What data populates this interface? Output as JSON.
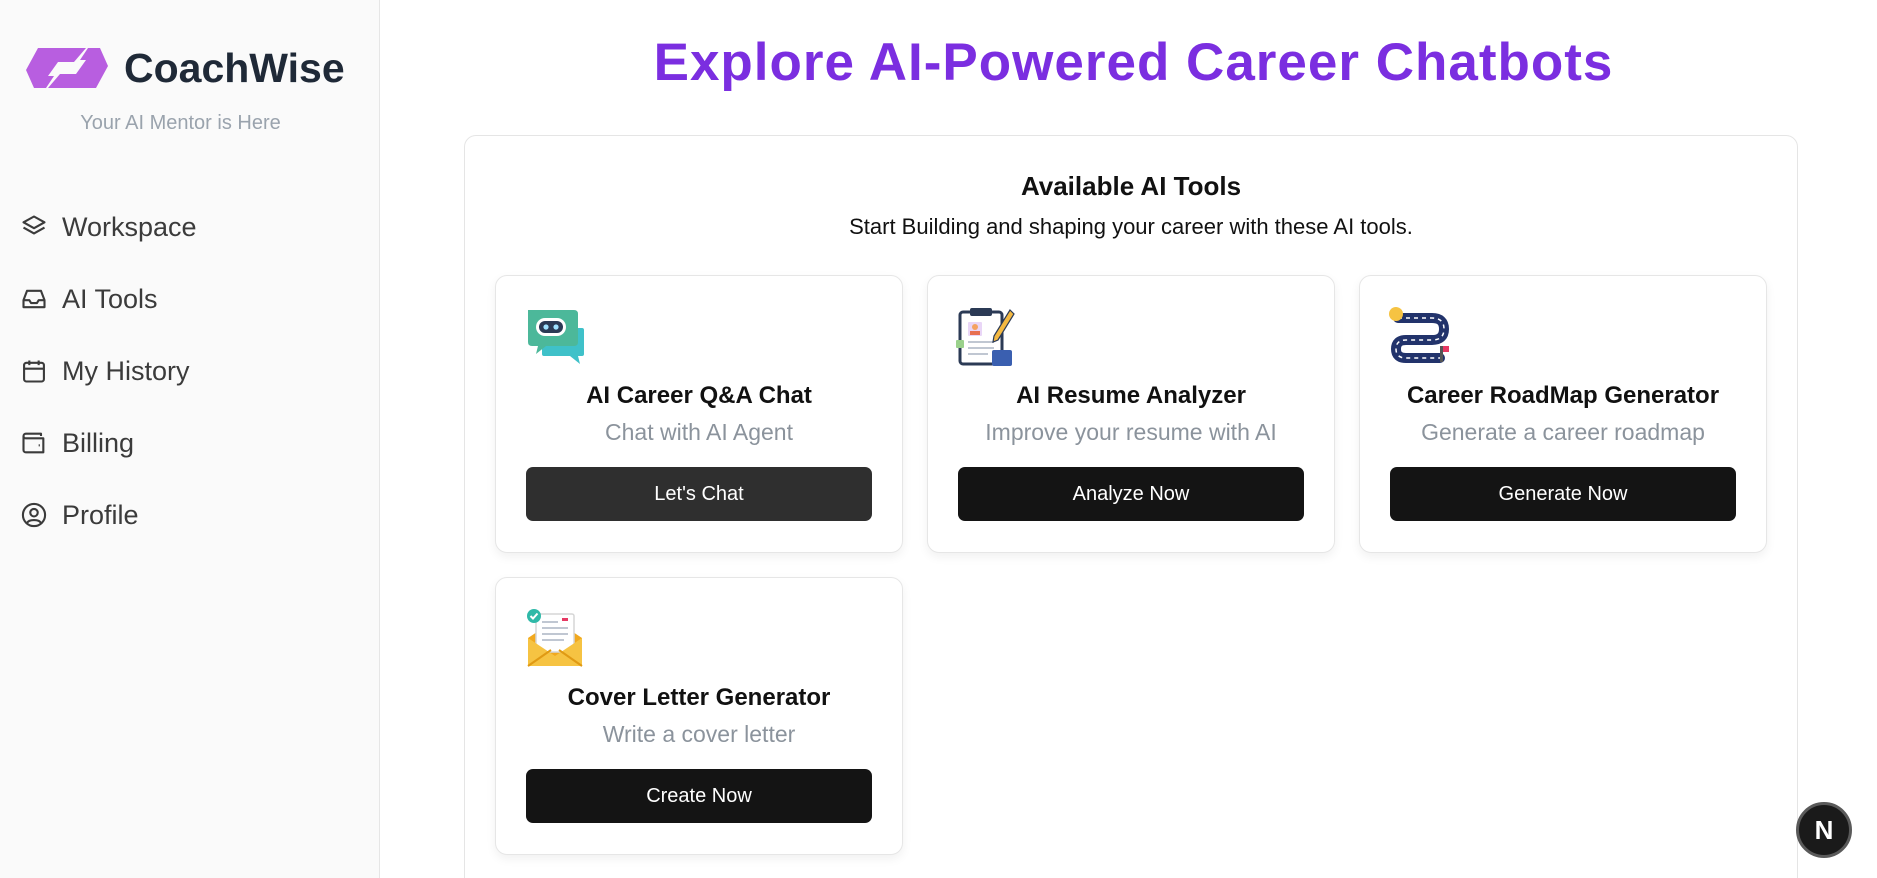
{
  "brand": {
    "name": "CoachWise",
    "tagline": "Your AI Mentor is Here",
    "accent_color": "#b85ee0"
  },
  "sidebar": {
    "items": [
      {
        "label": "Workspace",
        "icon": "layers-icon"
      },
      {
        "label": "AI Tools",
        "icon": "inbox-icon"
      },
      {
        "label": "My History",
        "icon": "calendar-icon"
      },
      {
        "label": "Billing",
        "icon": "wallet-icon"
      },
      {
        "label": "Profile",
        "icon": "user-circle-icon"
      }
    ]
  },
  "main": {
    "title": "Explore AI-Powered Career Chatbots",
    "title_color": "#7b2ee0",
    "panel": {
      "title": "Available AI Tools",
      "subtitle": "Start Building and shaping your career with these AI tools."
    },
    "tools": [
      {
        "title": "AI Career Q&A Chat",
        "description": "Chat with AI Agent",
        "button": "Let's Chat",
        "icon": "chat-bot-icon"
      },
      {
        "title": "AI Resume Analyzer",
        "description": "Improve your resume with AI",
        "button": "Analyze Now",
        "icon": "resume-icon"
      },
      {
        "title": "Career RoadMap Generator",
        "description": "Generate a career roadmap",
        "button": "Generate Now",
        "icon": "roadmap-icon"
      },
      {
        "title": "Cover Letter Generator",
        "description": "Write a cover letter",
        "button": "Create Now",
        "icon": "envelope-letter-icon"
      }
    ]
  },
  "fab": {
    "label": "N",
    "icon": "nextjs-icon"
  }
}
